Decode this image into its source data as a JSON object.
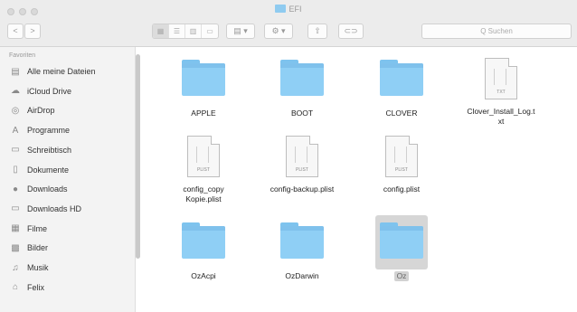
{
  "window": {
    "title": "EFI",
    "search_placeholder": "Q Suchen"
  },
  "toolbar": {
    "back_label": "<",
    "forward_label": ">",
    "view_icons": [
      "grid-view-icon",
      "list-view-icon",
      "column-view-icon",
      "coverflow-view-icon"
    ],
    "arrange_label": "▤ ▾",
    "action_label": "⚙ ▾",
    "share_label": "⇧",
    "tags_label": "⊂⊃"
  },
  "sidebar": {
    "header": "Favoriten",
    "items": [
      {
        "label": "Alle meine Dateien",
        "icon": "all-files-icon",
        "glyph": "▤"
      },
      {
        "label": "iCloud Drive",
        "icon": "cloud-icon",
        "glyph": "☁"
      },
      {
        "label": "AirDrop",
        "icon": "airdrop-icon",
        "glyph": "◎"
      },
      {
        "label": "Programme",
        "icon": "applications-icon",
        "glyph": "A"
      },
      {
        "label": "Schreibtisch",
        "icon": "desktop-icon",
        "glyph": "▭"
      },
      {
        "label": "Dokumente",
        "icon": "documents-icon",
        "glyph": "▯"
      },
      {
        "label": "Downloads",
        "icon": "downloads-icon",
        "glyph": "●"
      },
      {
        "label": "Downloads HD",
        "icon": "folder-icon",
        "glyph": "▭"
      },
      {
        "label": "Filme",
        "icon": "movies-icon",
        "glyph": "▦"
      },
      {
        "label": "Bilder",
        "icon": "pictures-icon",
        "glyph": "▩"
      },
      {
        "label": "Musik",
        "icon": "music-icon",
        "glyph": "♫"
      },
      {
        "label": "Felix",
        "icon": "home-icon",
        "glyph": "⌂"
      }
    ]
  },
  "files": [
    {
      "name": "APPLE",
      "kind": "folder"
    },
    {
      "name": "BOOT",
      "kind": "folder"
    },
    {
      "name": "CLOVER",
      "kind": "folder"
    },
    {
      "name": "Clover_Install_Log.t\nxt",
      "kind": "doc",
      "tag": "TXT"
    },
    {
      "name": "config_copy\nKopie.plist",
      "kind": "doc",
      "tag": "PLIST"
    },
    {
      "name": "config-backup.plist",
      "kind": "doc",
      "tag": "PLIST"
    },
    {
      "name": "config.plist",
      "kind": "doc",
      "tag": "PLIST"
    },
    {
      "name": "OzAcpi",
      "kind": "folder"
    },
    {
      "name": "OzDarwin",
      "kind": "folder"
    },
    {
      "name": "Oz",
      "kind": "folder",
      "selected": true
    }
  ],
  "colors": {
    "folder": "#8fcff5",
    "selection": "#d6d6d6",
    "sidebar_bg": "#f3f3f3"
  }
}
